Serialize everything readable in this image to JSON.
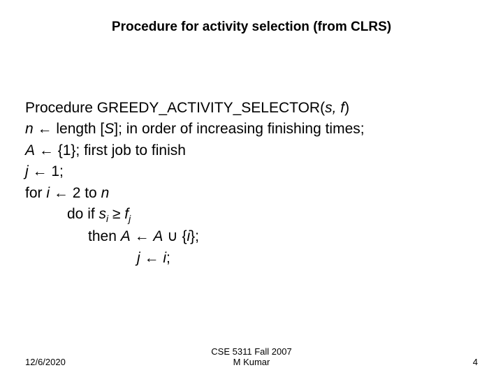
{
  "title": "Procedure for activity selection (from CLRS)",
  "proc": {
    "sig_pre": "Procedure GREEDY_ACTIVITY_SELECTOR(",
    "sig_args": "s, f",
    "sig_post": ")",
    "n": "n",
    "assign": " ← ",
    "len_text": "length [",
    "S": "S",
    "len_tail": "]; in order of increasing finishing times;",
    "A": "A",
    "set1": " {1}; first job to finish",
    "j": "j",
    "one": " 1;",
    "for_pre": "for ",
    "i": "i",
    "two_to": " 2 to ",
    "n2": "n",
    "do_if": "do if ",
    "s": "s",
    "sub_i": "i",
    "geq": " ≥ ",
    "f": "f",
    "sub_j": "j",
    "then": "then ",
    "A2": "A",
    "A3": "A",
    "cup": " ∪ {",
    "i2": "i",
    "brace_semi": "};",
    "j2": "j",
    "i3": "i",
    "semi": ";"
  },
  "footer": {
    "date": "12/6/2020",
    "course1": "CSE 5311 Fall 2007",
    "course2": "M Kumar",
    "page": "4"
  }
}
